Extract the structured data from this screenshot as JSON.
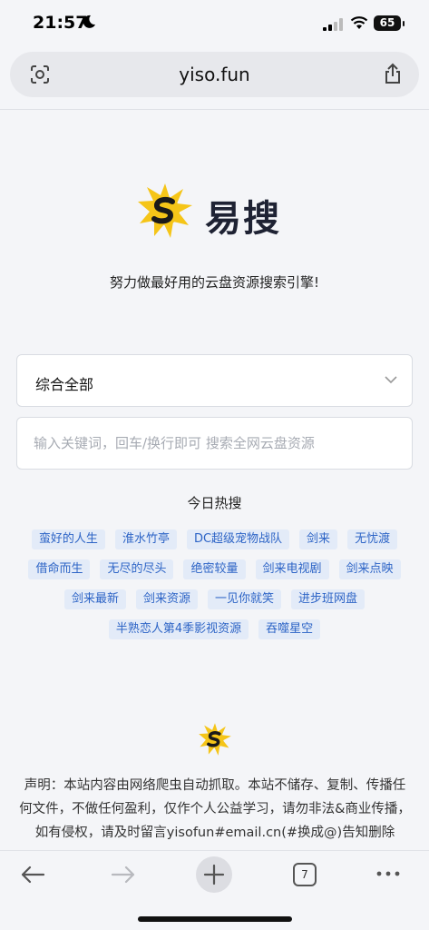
{
  "status": {
    "time": "21:57",
    "battery": "65"
  },
  "browser": {
    "url": "yiso.fun",
    "tab_count": "7"
  },
  "site": {
    "name": "易搜",
    "tagline": "努力做最好用的云盘资源搜索引擎!",
    "category_select": "综合全部",
    "search_placeholder": "输入关键词，回车/换行即可 搜索全网云盘资源",
    "hot_title": "今日热搜",
    "hot_tags": [
      "蛮好的人生",
      "淮水竹亭",
      "DC超级宠物战队",
      "剑来",
      "无忧渡",
      "借命而生",
      "无尽的尽头",
      "绝密较量",
      "剑来电视剧",
      "剑来点映",
      "剑来最新",
      "剑来资源",
      "一见你就笑",
      "进步班网盘",
      "半熟恋人第4季影视资源",
      "吞噬星空"
    ],
    "disclaimer": "声明：本站内容由网络爬虫自动抓取。本站不储存、复制、传播任何文件，不做任何盈利，仅作个人公益学习，请勿非法&商业传播，如有侵权，请及时留言yisofun#email.cn(#换成@)告知删除"
  },
  "colors": {
    "tag_bg": "#e3ebf8",
    "tag_text": "#2d64c6",
    "logo_yellow": "#f5c518"
  },
  "icons": [
    "moon-icon",
    "signal-icon",
    "wifi-icon",
    "lens-icon",
    "share-icon",
    "chevron-down-icon",
    "back-icon",
    "forward-icon",
    "plus-icon",
    "tabs-icon",
    "more-icon"
  ]
}
